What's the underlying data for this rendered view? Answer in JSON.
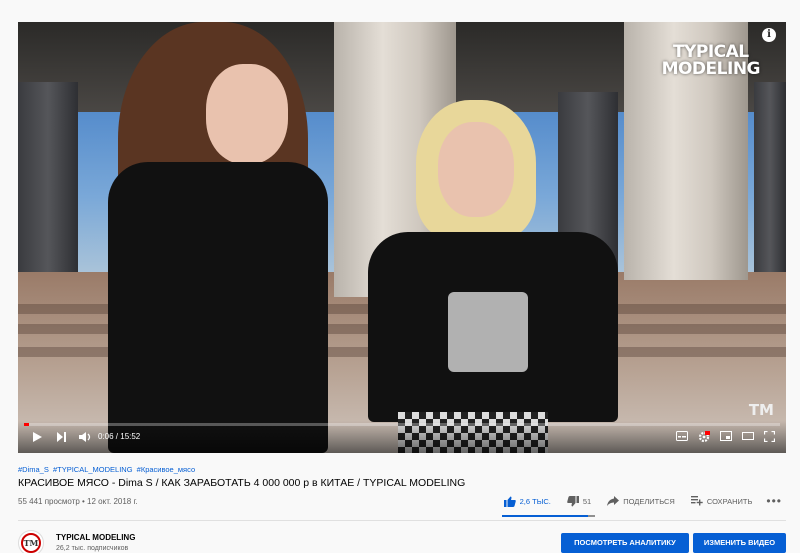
{
  "player": {
    "watermark_line1": "TYPICAL",
    "watermark_line2": "MODELING",
    "corner_logo": "TM",
    "info_icon": "i",
    "time_current": "0:06",
    "time_total": "15:52",
    "time_display": "0:06 / 15:52",
    "progress": 0.006
  },
  "video": {
    "tags": [
      "#Dima_S",
      "#TYPICAL_MODELING",
      "#Красивое_мясо"
    ],
    "title": "КРАСИВОЕ МЯСО - Dima S / КАК ЗАРАБОТАТЬ 4 000 000 р в КИТАЕ / TYPICAL MODELING",
    "views": "55 441 просмотр",
    "date": "12 окт. 2018 г.",
    "meta_line": "55 441 просмотр • 12 окт. 2018 г.",
    "likes": "2,6 ТЫС.",
    "dislikes": "51",
    "share_label": "ПОДЕЛИТЬСЯ",
    "save_label": "СОХРАНИТЬ",
    "like_ratio": 0.98
  },
  "channel": {
    "avatar_text": "TM",
    "name": "TYPICAL MODELING",
    "subscribers": "26,2 тыс. подписчиков"
  },
  "buttons": {
    "analytics": "ПОСМОТРЕТЬ АНАЛИТИКУ",
    "edit": "ИЗМЕНИТЬ ВИДЕО"
  },
  "colors": {
    "accent": "#065fd4",
    "progress": "#ff0000"
  }
}
